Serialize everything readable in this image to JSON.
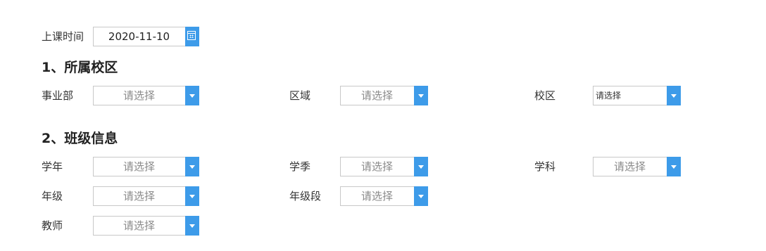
{
  "class_time": {
    "label": "上课时间",
    "value": "2020-11-10"
  },
  "section1": {
    "title": "1、所属校区"
  },
  "section2": {
    "title": "2、班级信息"
  },
  "placeholder": "请选择",
  "fields": {
    "division": {
      "label": "事业部",
      "value": "请选择"
    },
    "region": {
      "label": "区域",
      "value": "请选择"
    },
    "campus": {
      "label": "校区",
      "value": "请选择"
    },
    "school_year": {
      "label": "学年",
      "value": "请选择"
    },
    "season": {
      "label": "学季",
      "value": "请选择"
    },
    "subject": {
      "label": "学科",
      "value": "请选择"
    },
    "grade": {
      "label": "年级",
      "value": "请选择"
    },
    "grade_level": {
      "label": "年级段",
      "value": "请选择"
    },
    "teacher": {
      "label": "教师",
      "value": "请选择"
    }
  },
  "icons": {
    "dropdown": "chevron-down-icon",
    "calendar": "calendar-icon"
  },
  "colors": {
    "accent": "#3d9be9",
    "border": "#c8c8c8",
    "placeholder_text": "#8a8a8a"
  }
}
